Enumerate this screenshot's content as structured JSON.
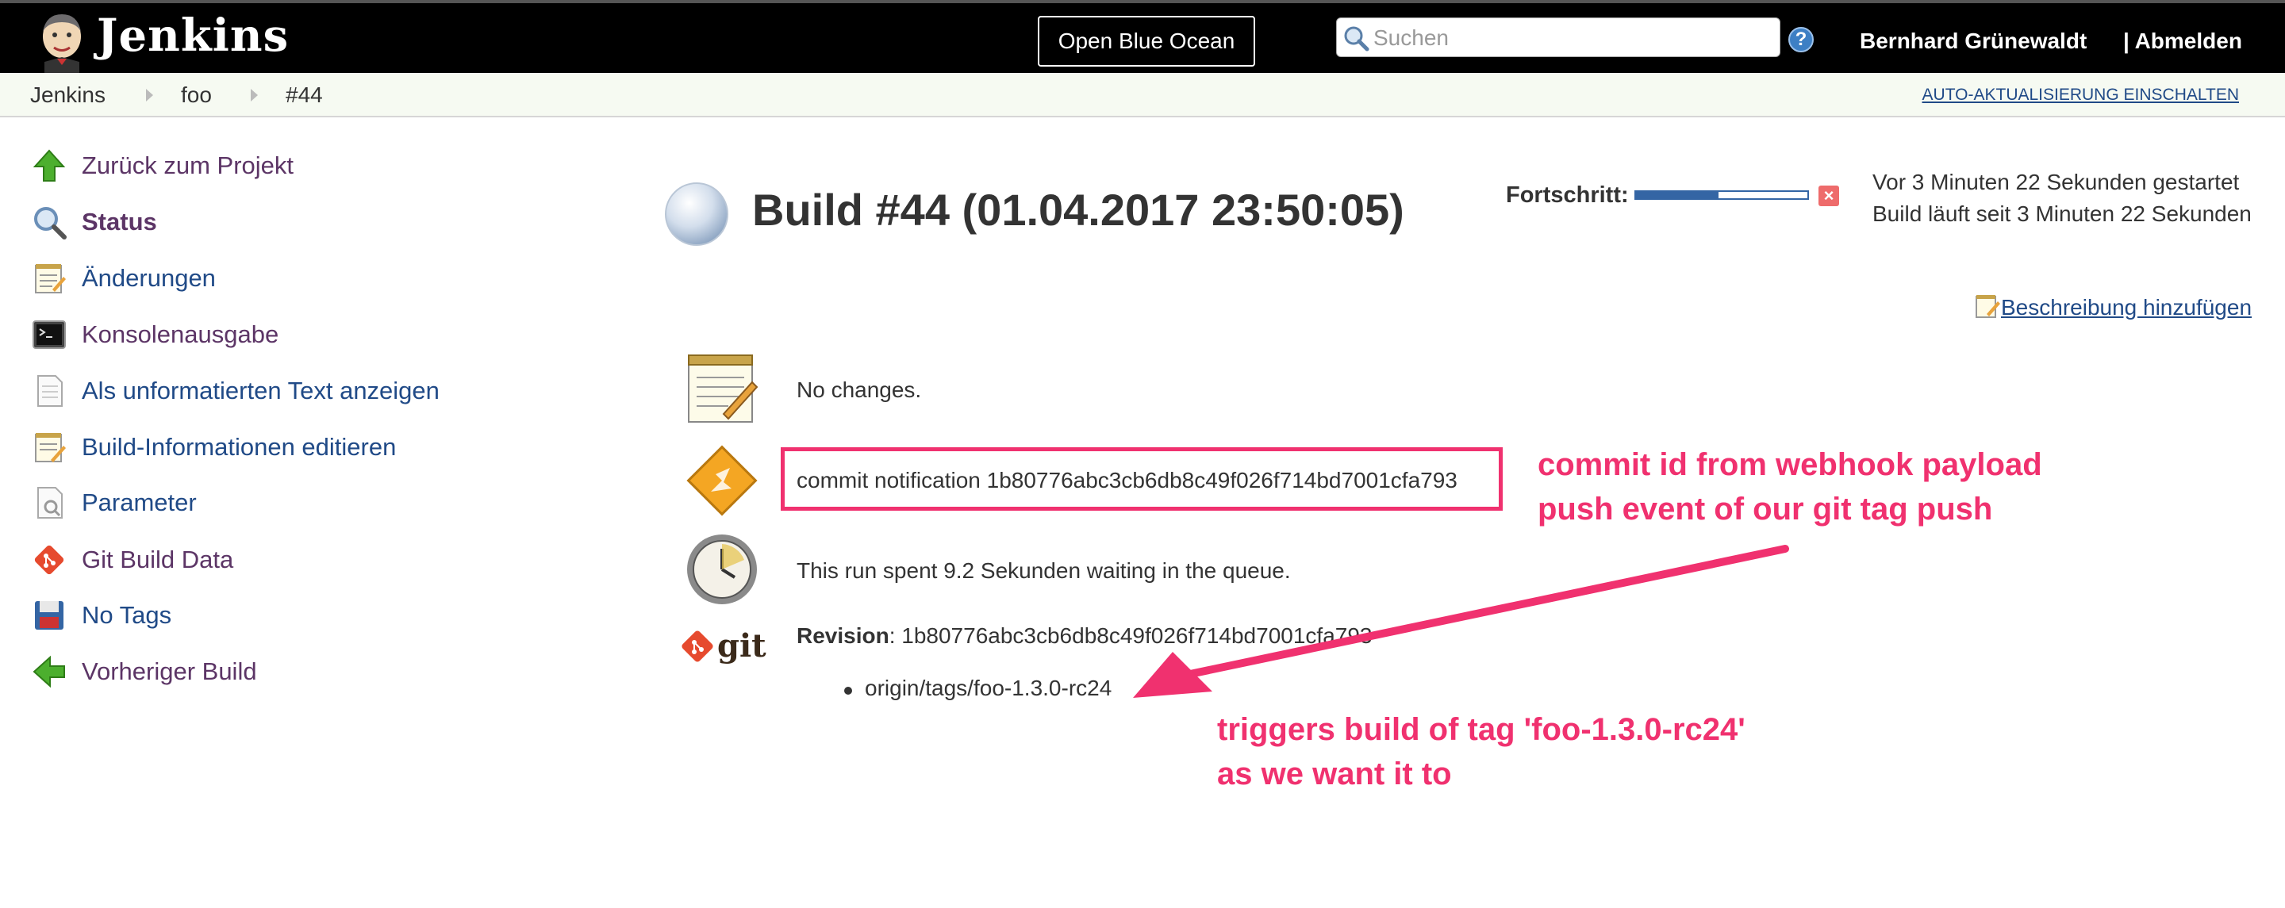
{
  "header": {
    "logo_text": "Jenkins",
    "blue_ocean_label": "Open Blue Ocean",
    "search_placeholder": "Suchen",
    "user_name": "Bernhard Grünewaldt",
    "logout_label": "| Abmelden"
  },
  "breadcrumb": {
    "items": [
      "Jenkins",
      "foo",
      "#44"
    ],
    "auto_refresh": "AUTO-AKTUALISIERUNG EINSCHALTEN"
  },
  "sidebar": {
    "items": [
      {
        "label": "Zurück zum Projekt",
        "icon": "up-arrow-icon"
      },
      {
        "label": "Status",
        "icon": "magnifier-icon"
      },
      {
        "label": "Änderungen",
        "icon": "notepad-icon"
      },
      {
        "label": "Konsolenausgabe",
        "icon": "terminal-icon"
      },
      {
        "label": "Als unformatierten Text anzeigen",
        "icon": "document-icon"
      },
      {
        "label": "Build-Informationen editieren",
        "icon": "notepad-edit-icon"
      },
      {
        "label": "Parameter",
        "icon": "document-search-icon"
      },
      {
        "label": "Git Build Data",
        "icon": "git-icon"
      },
      {
        "label": "No Tags",
        "icon": "save-icon"
      },
      {
        "label": "Vorheriger Build",
        "icon": "left-arrow-icon"
      }
    ]
  },
  "build": {
    "title": "Build #44 (01.04.2017 23:50:05)",
    "progress_label": "Fortschritt:",
    "progress_fraction": 0.48,
    "started": "Vor 3 Minuten 22 Sekunden gestartet",
    "running": "Build läuft seit 3 Minuten 22 Sekunden",
    "add_description": "Beschreibung hinzufügen",
    "changes": "No changes.",
    "commit_notification": "commit notification 1b80776abc3cb6db8c49f026f714bd7001cfa793",
    "queue_text": "This run spent 9.2 Sekunden waiting in the queue.",
    "revision_label": "Revision",
    "revision_value": ": 1b80776abc3cb6db8c49f026f714bd7001cfa793",
    "tag": "origin/tags/foo-1.3.0-rc24"
  },
  "annotations": {
    "commit_note_line1": "commit id from webhook payload",
    "commit_note_line2": "push event of our git tag push",
    "trigger_note_line1": "triggers build of tag 'foo-1.3.0-rc24'",
    "trigger_note_line2": "as we want it to"
  },
  "colors": {
    "header_bg": "#000000",
    "link": "#204a87",
    "visited": "#5c3566",
    "annotation": "#f0316f",
    "progress": "#3465a4"
  }
}
